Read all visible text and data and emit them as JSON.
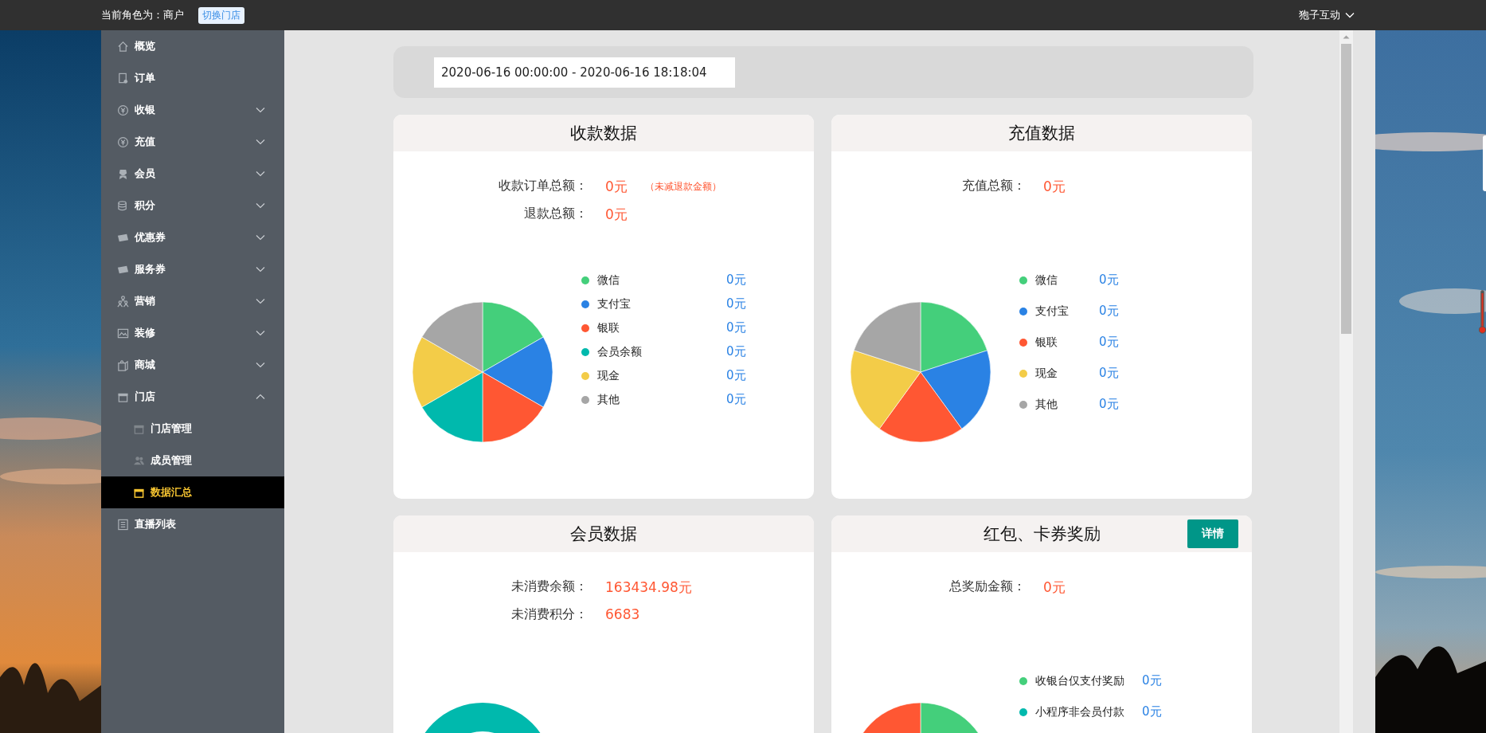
{
  "top_bar": {
    "role_text": "当前角色为：商户",
    "switch_store_button": "切换门店",
    "account_menu": "狍子互动"
  },
  "sidebar": {
    "items": [
      {
        "label": "概览",
        "kind": "link",
        "selected": false
      },
      {
        "label": "订单",
        "kind": "link",
        "selected": false
      },
      {
        "label": "收银",
        "kind": "group",
        "expanded": false,
        "selected": false
      },
      {
        "label": "充值",
        "kind": "group",
        "expanded": false,
        "selected": false
      },
      {
        "label": "会员",
        "kind": "group",
        "expanded": false,
        "selected": false
      },
      {
        "label": "积分",
        "kind": "group",
        "expanded": false,
        "selected": false
      },
      {
        "label": "优惠券",
        "kind": "group",
        "expanded": false,
        "selected": false
      },
      {
        "label": "服务券",
        "kind": "group",
        "expanded": false,
        "selected": false
      },
      {
        "label": "营销",
        "kind": "group",
        "expanded": false,
        "selected": false
      },
      {
        "label": "装修",
        "kind": "group",
        "expanded": false,
        "selected": false
      },
      {
        "label": "商城",
        "kind": "group",
        "expanded": false,
        "selected": false
      },
      {
        "label": "门店",
        "kind": "group",
        "expanded": true,
        "selected": false,
        "children": [
          {
            "label": "门店管理",
            "selected": false
          },
          {
            "label": "成员管理",
            "selected": false
          },
          {
            "label": "数据汇总",
            "selected": true
          }
        ]
      },
      {
        "label": "直播列表",
        "kind": "link",
        "selected": false
      }
    ]
  },
  "filter_bar": {
    "date_range": {
      "value": "2020-06-16 00:00:00 - 2020-06-16 18:18:04"
    }
  },
  "panels": [
    {
      "title": "收款数据",
      "stats": [
        {
          "label": "收款订单总额：",
          "value": "0元",
          "note": "（未减退款金额）"
        },
        {
          "label": "退款总额：",
          "value": "0元"
        }
      ],
      "chart": {
        "kind": "pie"
      },
      "legend": [
        {
          "label": "微信",
          "value": "0元",
          "color": "#44cf7b"
        },
        {
          "label": "支付宝",
          "value": "0元",
          "color": "#2a82e4"
        },
        {
          "label": "银联",
          "value": "0元",
          "color": "#ff5733"
        },
        {
          "label": "会员余额",
          "value": "0元",
          "color": "#00b9ad"
        },
        {
          "label": "现金",
          "value": "0元",
          "color": "#f3cc48"
        },
        {
          "label": "其他",
          "value": "0元",
          "color": "#a6a6a6"
        }
      ]
    },
    {
      "title": "充值数据",
      "stats": [
        {
          "label": "充值总额：",
          "value": "0元"
        }
      ],
      "chart": {
        "kind": "pie"
      },
      "legend": [
        {
          "label": "微信",
          "value": "0元",
          "color": "#44cf7b"
        },
        {
          "label": "支付宝",
          "value": "0元",
          "color": "#2a82e4"
        },
        {
          "label": "银联",
          "value": "0元",
          "color": "#ff5733"
        },
        {
          "label": "现金",
          "value": "0元",
          "color": "#f3cc48"
        },
        {
          "label": "其他",
          "value": "0元",
          "color": "#a6a6a6"
        }
      ]
    },
    {
      "title": "会员数据",
      "stats": [
        {
          "label": "未消费余额：",
          "value": "163434.98元"
        },
        {
          "label": "未消费积分：",
          "value": "6683"
        }
      ],
      "chart": {
        "kind": "donut"
      }
    },
    {
      "title": "红包、卡券奖励",
      "action_button": "详情",
      "stats": [
        {
          "label": "总奖励金额：",
          "value": "0元"
        }
      ],
      "chart": {
        "kind": "pie"
      },
      "legend": [
        {
          "label": "收银台仅支付奖励",
          "value": "0元",
          "color": "#44cf7b"
        },
        {
          "label": "小程序非会员付款",
          "value": "0元",
          "color": "#00b9ad"
        }
      ]
    }
  ]
}
